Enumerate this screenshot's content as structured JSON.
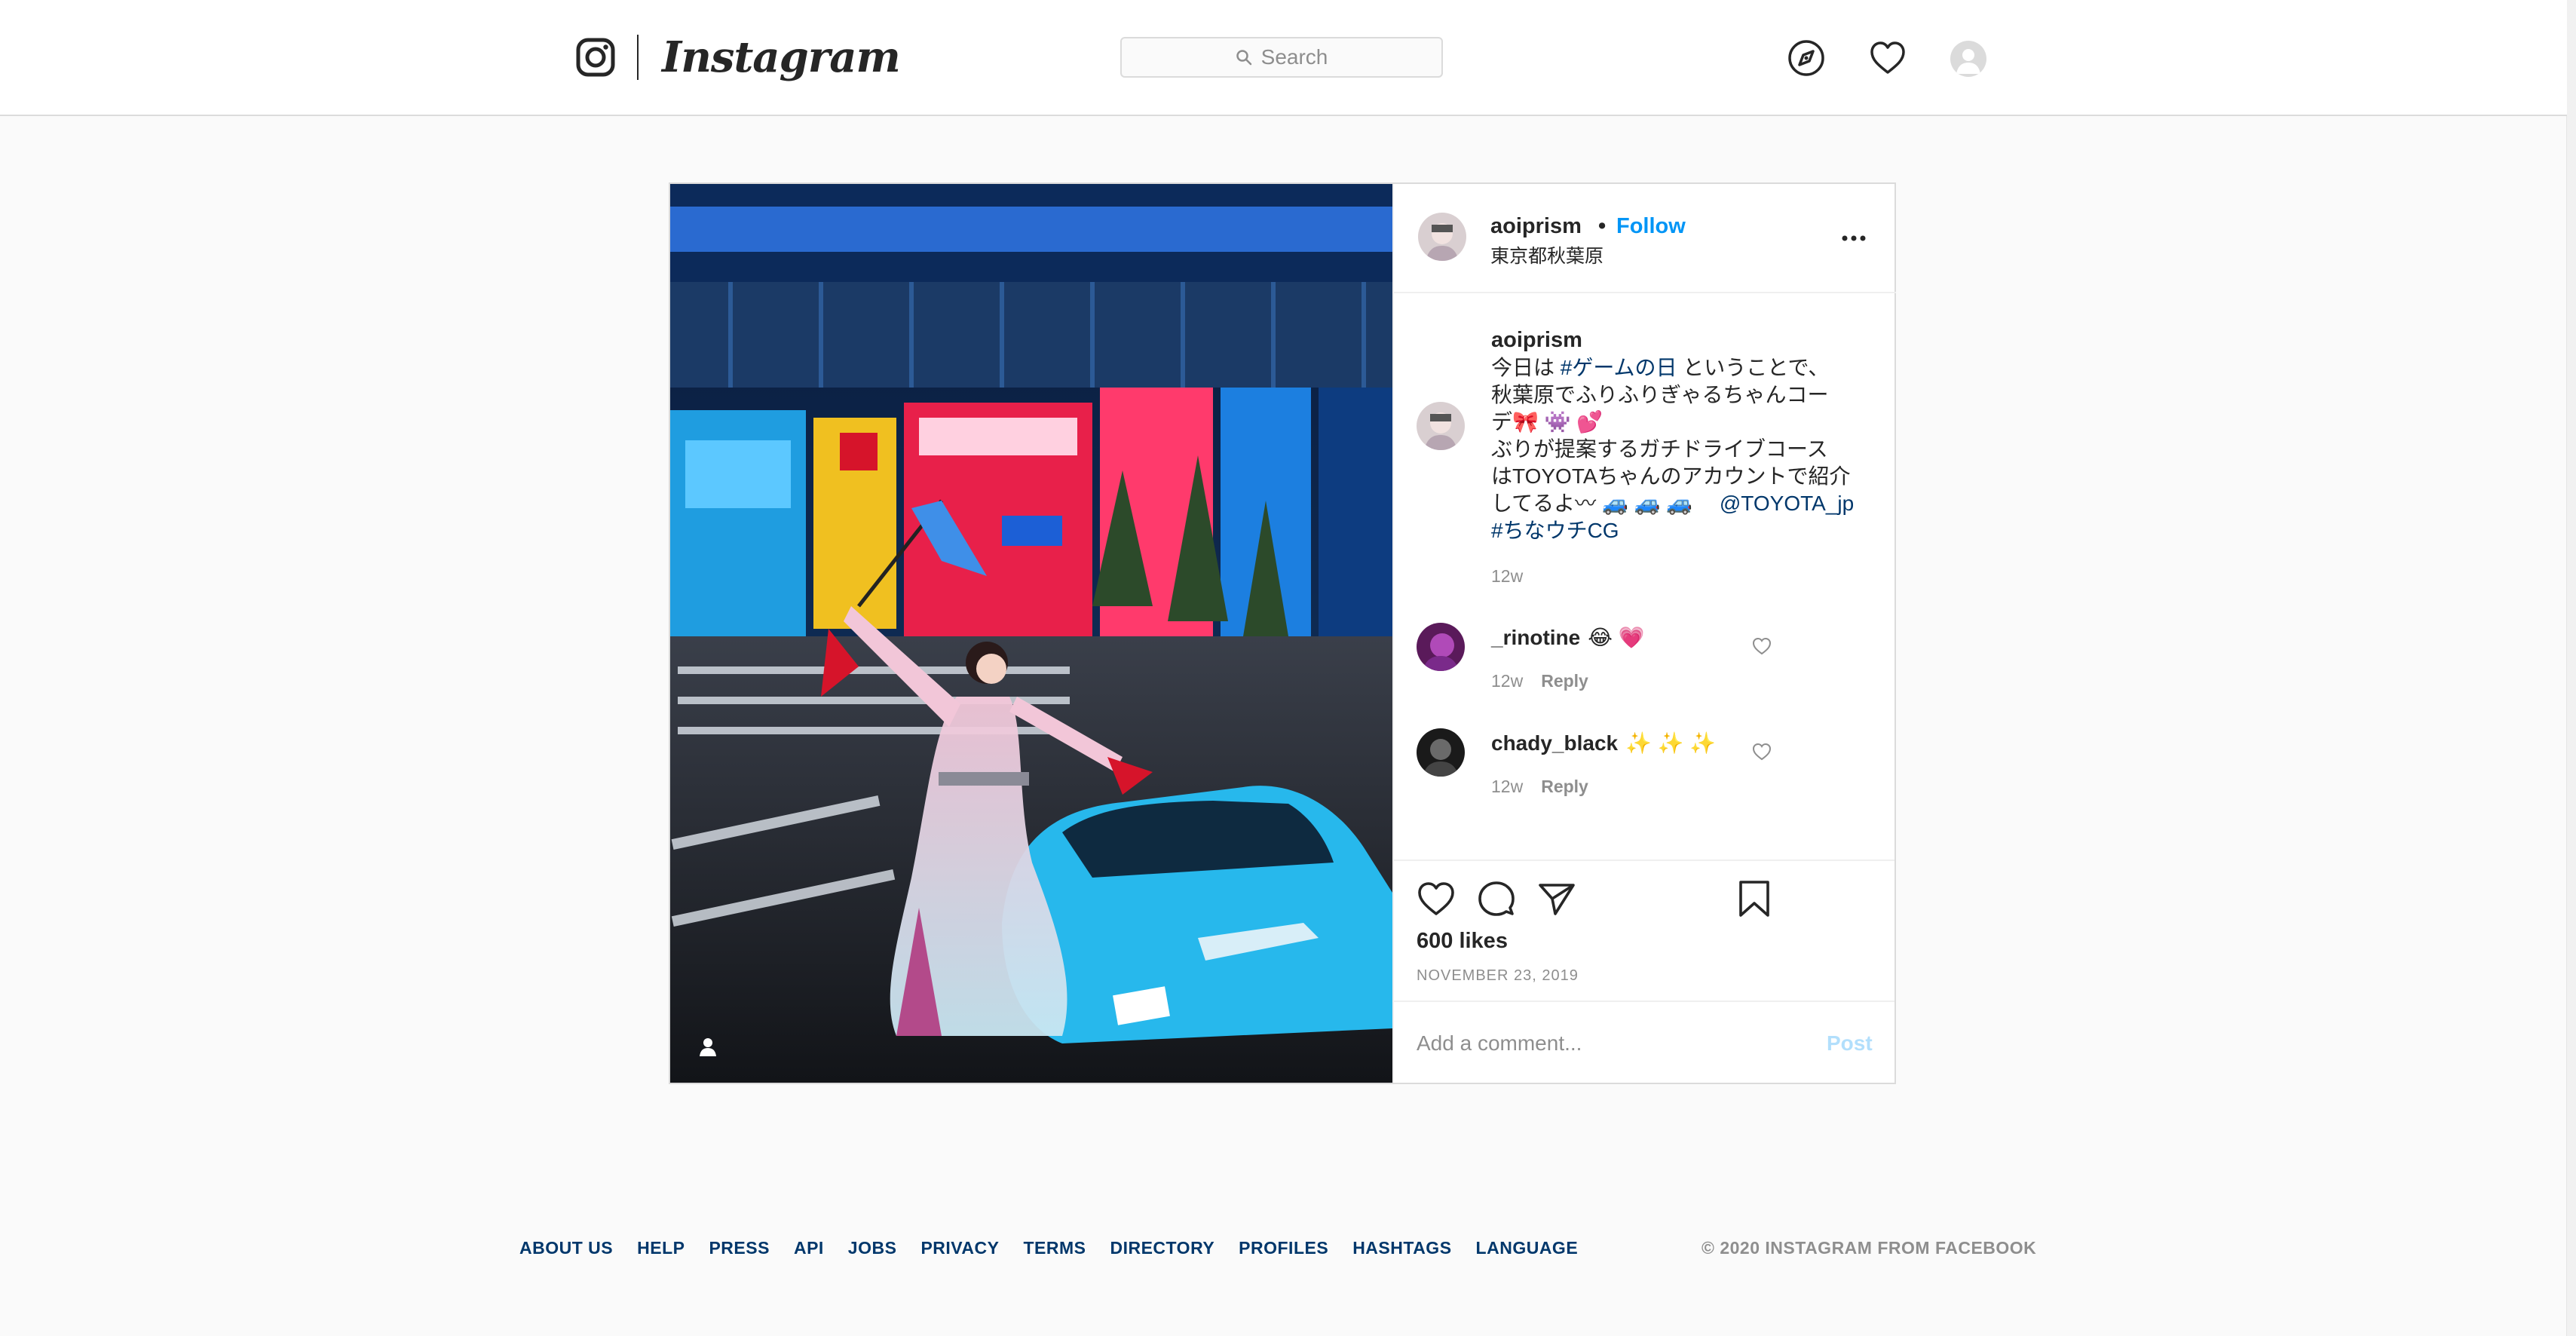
{
  "header": {
    "brand": "Instagram",
    "search_placeholder": "Search",
    "icons": [
      "instagram-glyph-icon",
      "search-icon",
      "compass-icon",
      "heart-icon",
      "profile-avatar"
    ]
  },
  "post": {
    "username": "aoiprism",
    "dot": "•",
    "follow_label": "Follow",
    "location": "東京都秋葉原",
    "caption": {
      "username": "aoiprism",
      "lines": [
        {
          "pre": "今日は ",
          "tag": "#ゲームの日",
          "post": " ということで、"
        },
        {
          "pre": "秋葉原でふりふりぎゃるちゃんコー",
          "tag": "",
          "post": ""
        },
        {
          "pre": "デ🎀 👾 💕",
          "tag": "",
          "post": ""
        },
        {
          "pre": "ぶりが提案するガチドライブコース",
          "tag": "",
          "post": ""
        },
        {
          "pre": "はTOYOTAちゃんのアカウントで紹介",
          "tag": "",
          "post": ""
        },
        {
          "pre": "してるよ〰 🚙 🚙 🚙 　",
          "tag": "@TOYOTA_jp",
          "post": ""
        },
        {
          "pre": "",
          "tag": "#ちなウチCG",
          "post": ""
        }
      ],
      "time": "12w"
    },
    "comments": [
      {
        "user": "_rinotine",
        "text": "😂 💗",
        "time": "12w",
        "reply": "Reply"
      },
      {
        "user": "chady_black",
        "text": "✨ ✨ ✨",
        "time": "12w",
        "reply": "Reply"
      }
    ],
    "likes": "600 likes",
    "date": "NOVEMBER 23, 2019",
    "add_comment_placeholder": "Add a comment...",
    "post_button": "Post",
    "accent_color": "#0095f6"
  },
  "footer": {
    "links": [
      "ABOUT US",
      "HELP",
      "PRESS",
      "API",
      "JOBS",
      "PRIVACY",
      "TERMS",
      "DIRECTORY",
      "PROFILES",
      "HASHTAGS",
      "LANGUAGE"
    ],
    "copyright": "© 2020 INSTAGRAM FROM FACEBOOK"
  }
}
